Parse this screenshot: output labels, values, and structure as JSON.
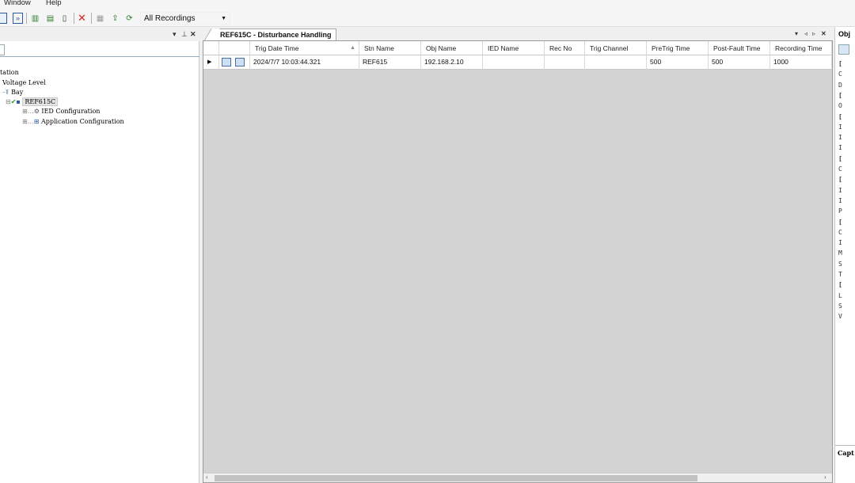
{
  "menu": {
    "window": "Window",
    "help": "Help"
  },
  "toolbar": {
    "recordings_filter": "All Recordings"
  },
  "left_panel": {
    "tree": [
      {
        "label": "tation"
      },
      {
        "label": "Voltage Level"
      },
      {
        "label": "Bay"
      },
      {
        "label": "REF615C"
      },
      {
        "label": "IED Configuration"
      },
      {
        "label": "Application Configuration"
      }
    ]
  },
  "document": {
    "tab_title": "REF615C - Disturbance Handling",
    "columns": [
      "Trig Date Time",
      "Stn Name",
      "Obj Name",
      "IED Name",
      "Rec No",
      "Trig Channel",
      "PreTrig Time",
      "Post-Fault Time",
      "Recording Time"
    ],
    "rows": [
      {
        "trig_date_time": "2024/7/7 10:03:44.321",
        "stn_name": "REF615",
        "obj_name": "192.168.2.10",
        "ied_name": "",
        "rec_no": "",
        "trig_channel": "",
        "pretrig_time": "500",
        "post_fault_time": "500",
        "recording_time": "1000"
      }
    ]
  },
  "right_panel": {
    "title": "Obj",
    "rows": [
      "[",
      "C",
      "D",
      "[",
      "O",
      "[",
      "I",
      "I",
      "I",
      "[",
      "C",
      "[",
      "I",
      "I",
      "P",
      "[",
      "C",
      "I",
      "M",
      "S",
      "T",
      "[",
      "L",
      "S",
      "V"
    ],
    "caption": "Capt"
  }
}
